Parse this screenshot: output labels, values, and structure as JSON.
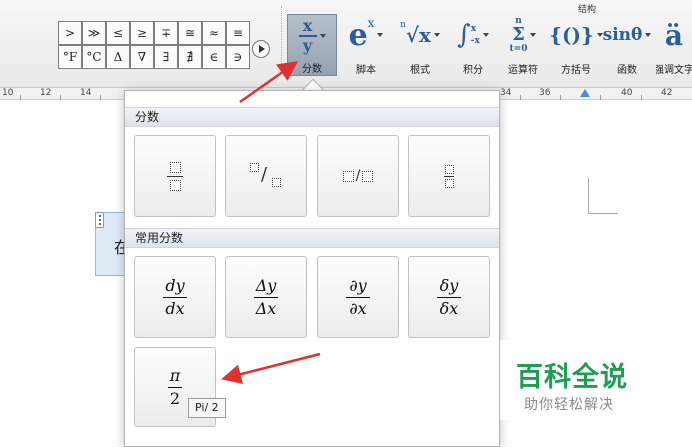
{
  "ribbon": {
    "group_title": "结构",
    "symbols_row1": [
      ">",
      "≫",
      "≤",
      "≥",
      "∓",
      "≅",
      "≈",
      "≡"
    ],
    "symbols_row2": [
      "°F",
      "°C",
      "Δ",
      "∇",
      "∃",
      "∄",
      "∈",
      "∋"
    ],
    "buttons": [
      {
        "id": "fraction",
        "label": "分数",
        "icon": "fraction-icon",
        "selected": true
      },
      {
        "id": "script",
        "label": "脚本",
        "icon": "superscript-icon"
      },
      {
        "id": "radical",
        "label": "根式",
        "icon": "radical-icon"
      },
      {
        "id": "integral",
        "label": "积分",
        "icon": "integral-icon"
      },
      {
        "id": "operator",
        "label": "运算符",
        "icon": "large-operator-icon"
      },
      {
        "id": "bracket",
        "label": "方括号",
        "icon": "bracket-icon"
      },
      {
        "id": "function",
        "label": "函数",
        "icon": "function-icon"
      },
      {
        "id": "accent",
        "label": "强调文字",
        "icon": "accent-icon"
      }
    ],
    "icon_text": {
      "fraction_num": "x",
      "fraction_den": "y",
      "script_base": "e",
      "script_sup": "x",
      "radical_index": "n",
      "radical_base": "√x",
      "integral_sign": "∫",
      "integral_upper": "x",
      "integral_lower": "-x",
      "operator_upper": "n",
      "operator_sign": "Σ",
      "operator_lower": "t=0",
      "bracket": "{()}",
      "function": "sinθ",
      "accent": "ä"
    }
  },
  "ruler": {
    "labels": [
      "10",
      "12",
      "14",
      "34",
      "36",
      "40",
      "42"
    ]
  },
  "document": {
    "equation_char": "在"
  },
  "dropdown": {
    "section1_title": "分数",
    "section2_title": "常用分数",
    "common_fractions": [
      {
        "num": "dy",
        "den": "dx"
      },
      {
        "num": "Δy",
        "den": "Δx"
      },
      {
        "num": "∂y",
        "den": "∂x"
      },
      {
        "num": "δy",
        "den": "δx"
      }
    ],
    "pi_fraction": {
      "num": "π",
      "den": "2"
    },
    "tooltip": "Pi/ 2"
  },
  "watermark": {
    "title": "百科全说",
    "subtitle": "助你轻松解决"
  },
  "colors": {
    "accent_arrow": "#e03030",
    "ribbon_icon": "#2b5d98",
    "watermark_green": "#1f9d55"
  }
}
